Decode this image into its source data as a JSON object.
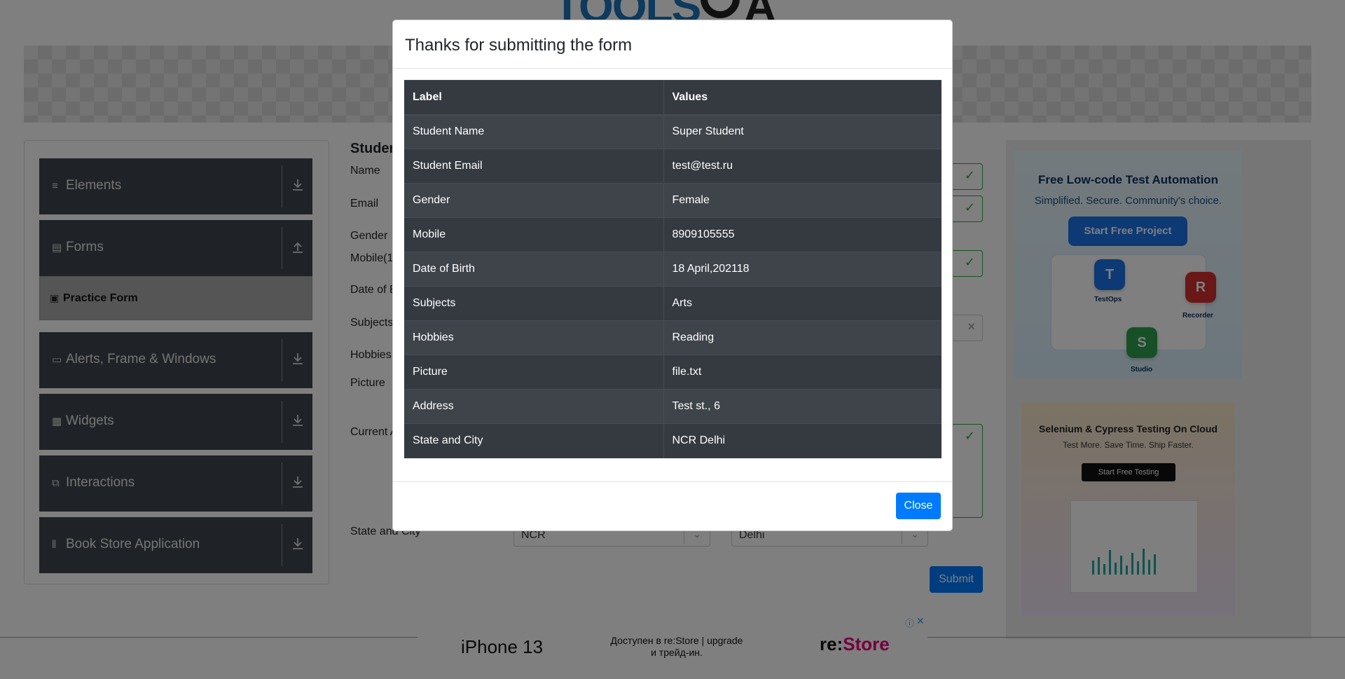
{
  "background": {
    "sidebar": {
      "groups": [
        {
          "label": "Elements",
          "icon": "hamburger-icon",
          "arrow": "download-icon"
        },
        {
          "label": "Forms",
          "icon": "form-icon",
          "arrow": "upload-icon"
        },
        {
          "label": "Alerts, Frame & Windows",
          "icon": "window-icon",
          "arrow": "download-icon"
        },
        {
          "label": "Widgets",
          "icon": "widgets-icon",
          "arrow": "download-icon"
        },
        {
          "label": "Interactions",
          "icon": "interactions-icon",
          "arrow": "download-icon"
        },
        {
          "label": "Book Store Application",
          "icon": "books-icon",
          "arrow": "download-icon"
        }
      ],
      "active_item": "Practice Form"
    },
    "form": {
      "title": "Studen",
      "labels": {
        "name": "Name",
        "email": "Email",
        "gender": "Gender",
        "mobile": "Mobile(1",
        "dob": "Date of B",
        "subjects": "Subjects",
        "hobbies": "Hobbies",
        "picture": "Picture",
        "address": "Current A",
        "state_city": "State and City"
      },
      "state_value": "NCR",
      "city_value": "Delhi",
      "submit_label": "Submit"
    },
    "ads": {
      "ad1": {
        "title": "Free Low-code Test Automation",
        "subtitle": "Simplified. Secure. Community's choice.",
        "button": "Start Free Project",
        "tiles": [
          "TestOps",
          "Recorder",
          "Studio"
        ]
      },
      "ad2": {
        "title": "Selenium & Cypress Testing On Cloud",
        "subtitle": "Test More. Save Time. Ship Faster.",
        "button": "Start Free Testing"
      },
      "bottom": {
        "product": "iPhone 13",
        "text": "Доступен в re:Store | upgrade и трейд-ин.",
        "brand_a": "re:",
        "brand_b": "Store"
      }
    }
  },
  "modal": {
    "title": "Thanks for submitting the form",
    "columns": [
      "Label",
      "Values"
    ],
    "rows": [
      {
        "label": "Student Name",
        "value": "Super Student"
      },
      {
        "label": "Student Email",
        "value": "test@test.ru"
      },
      {
        "label": "Gender",
        "value": "Female"
      },
      {
        "label": "Mobile",
        "value": "8909105555"
      },
      {
        "label": "Date of Birth",
        "value": "18 April,202118"
      },
      {
        "label": "Subjects",
        "value": "Arts"
      },
      {
        "label": "Hobbies",
        "value": "Reading"
      },
      {
        "label": "Picture",
        "value": "file.txt"
      },
      {
        "label": "Address",
        "value": "Test st., 6"
      },
      {
        "label": "State and City",
        "value": "NCR Delhi"
      }
    ],
    "close_label": "Close"
  },
  "colors": {
    "primary": "#007bff",
    "table_dark": "#343a40",
    "sidebar_dark": "#3f4650",
    "valid_green": "#28a745"
  }
}
